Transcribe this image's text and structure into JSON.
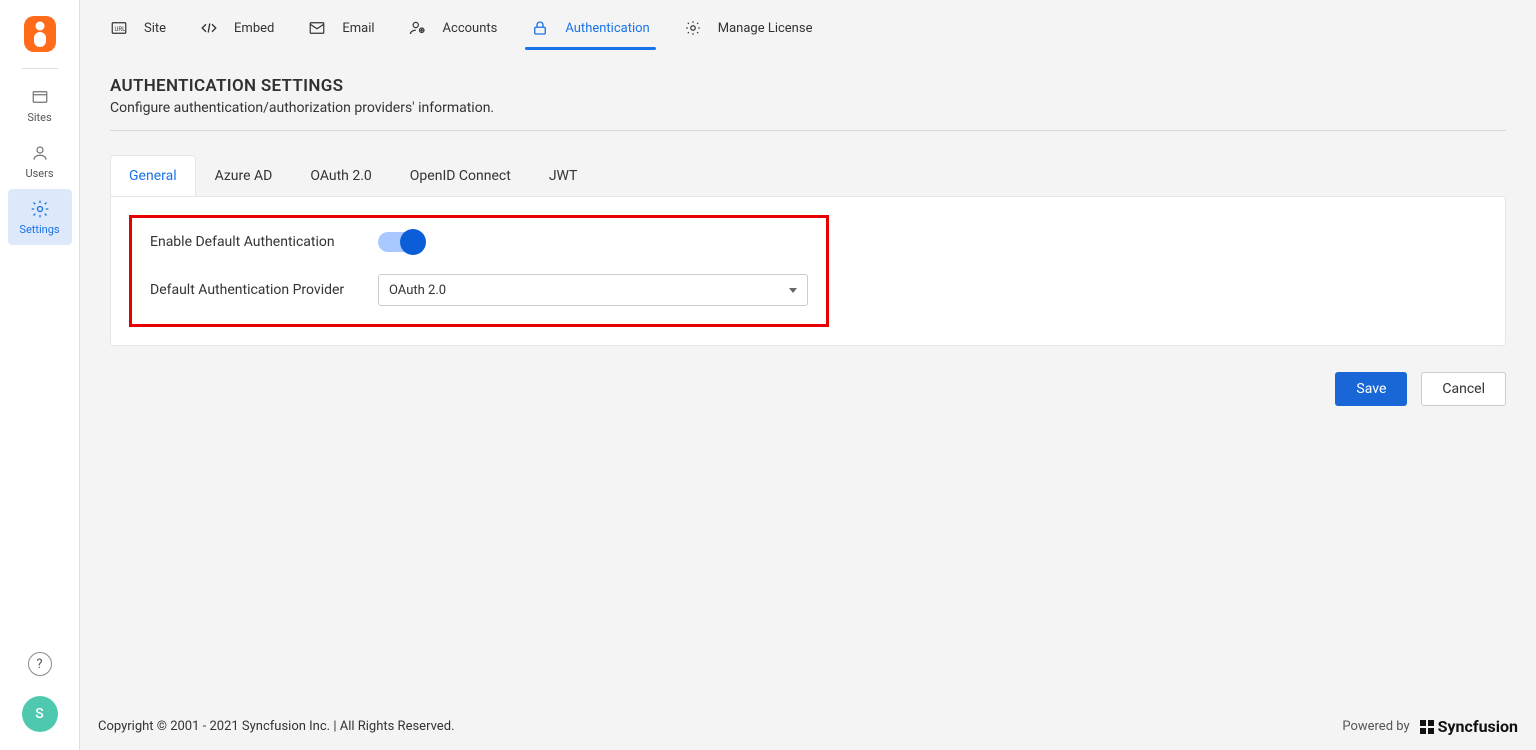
{
  "sidebar": {
    "items": [
      {
        "label": "Sites"
      },
      {
        "label": "Users"
      },
      {
        "label": "Settings"
      }
    ],
    "avatar_initial": "S",
    "help_glyph": "?"
  },
  "topnav": {
    "items": [
      {
        "label": "Site"
      },
      {
        "label": "Embed"
      },
      {
        "label": "Email"
      },
      {
        "label": "Accounts"
      },
      {
        "label": "Authentication"
      },
      {
        "label": "Manage License"
      }
    ]
  },
  "page": {
    "title": "AUTHENTICATION SETTINGS",
    "subtitle": "Configure authentication/authorization providers' information."
  },
  "tabs": [
    {
      "label": "General"
    },
    {
      "label": "Azure AD"
    },
    {
      "label": "OAuth 2.0"
    },
    {
      "label": "OpenID Connect"
    },
    {
      "label": "JWT"
    }
  ],
  "form": {
    "enable_label": "Enable Default Authentication",
    "provider_label": "Default Authentication Provider",
    "provider_value": "OAuth 2.0"
  },
  "buttons": {
    "save": "Save",
    "cancel": "Cancel"
  },
  "footer": {
    "copyright": "Copyright © 2001 - 2021 Syncfusion Inc. | All Rights Reserved.",
    "powered_by": "Powered by",
    "brand": "Syncfusion"
  }
}
